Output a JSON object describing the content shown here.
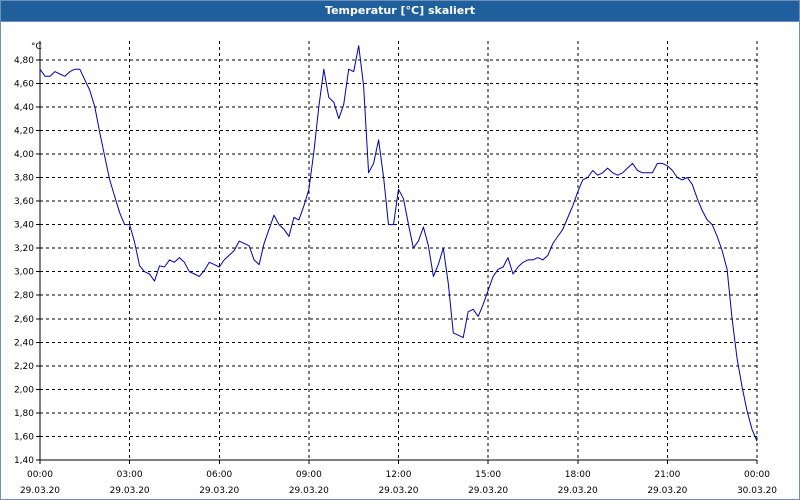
{
  "window": {
    "title": "Temperatur [°C] skaliert"
  },
  "chart_data": {
    "type": "line",
    "title": "Temperatur [°C] skaliert",
    "ylabel": "°C",
    "xlabel": "",
    "ylim": [
      1.4,
      4.96
    ],
    "grid": true,
    "y_ticks": [
      "1,40",
      "1,60",
      "1,80",
      "2,00",
      "2,20",
      "2,40",
      "2,60",
      "2,80",
      "3,00",
      "3,20",
      "3,40",
      "3,60",
      "3,80",
      "4,00",
      "4,20",
      "4,40",
      "4,60",
      "4,80"
    ],
    "x_ticks": [
      {
        "time": "00:00",
        "date": "29.03.20"
      },
      {
        "time": "03:00",
        "date": "29.03.20"
      },
      {
        "time": "06:00",
        "date": "29.03.20"
      },
      {
        "time": "09:00",
        "date": "29.03.20"
      },
      {
        "time": "12:00",
        "date": "29.03.20"
      },
      {
        "time": "15:00",
        "date": "29.03.20"
      },
      {
        "time": "18:00",
        "date": "29.03.20"
      },
      {
        "time": "21:00",
        "date": "29.03.20"
      },
      {
        "time": "00:00",
        "date": "30.03.20"
      }
    ],
    "series": [
      {
        "color": "#0000b4",
        "x": [
          "29.03.20 00:00",
          "29.03.20 00:10",
          "29.03.20 00:20",
          "29.03.20 00:30",
          "29.03.20 00:40",
          "29.03.20 00:50",
          "29.03.20 01:00",
          "29.03.20 01:10",
          "29.03.20 01:20",
          "29.03.20 01:30",
          "29.03.20 01:40",
          "29.03.20 01:50",
          "29.03.20 02:00",
          "29.03.20 02:10",
          "29.03.20 02:20",
          "29.03.20 02:30",
          "29.03.20 02:40",
          "29.03.20 02:50",
          "29.03.20 03:00",
          "29.03.20 03:10",
          "29.03.20 03:20",
          "29.03.20 03:30",
          "29.03.20 03:40",
          "29.03.20 03:50",
          "29.03.20 04:00",
          "29.03.20 04:10",
          "29.03.20 04:20",
          "29.03.20 04:30",
          "29.03.20 04:40",
          "29.03.20 04:50",
          "29.03.20 05:00",
          "29.03.20 05:10",
          "29.03.20 05:20",
          "29.03.20 05:30",
          "29.03.20 05:40",
          "29.03.20 05:50",
          "29.03.20 06:00",
          "29.03.20 06:10",
          "29.03.20 06:20",
          "29.03.20 06:30",
          "29.03.20 06:40",
          "29.03.20 06:50",
          "29.03.20 07:00",
          "29.03.20 07:10",
          "29.03.20 07:20",
          "29.03.20 07:30",
          "29.03.20 07:40",
          "29.03.20 07:50",
          "29.03.20 08:00",
          "29.03.20 08:10",
          "29.03.20 08:20",
          "29.03.20 08:30",
          "29.03.20 08:40",
          "29.03.20 08:50",
          "29.03.20 09:00",
          "29.03.20 09:10",
          "29.03.20 09:20",
          "29.03.20 09:30",
          "29.03.20 09:40",
          "29.03.20 09:50",
          "29.03.20 10:00",
          "29.03.20 10:10",
          "29.03.20 10:20",
          "29.03.20 10:30",
          "29.03.20 10:40",
          "29.03.20 10:50",
          "29.03.20 11:00",
          "29.03.20 11:10",
          "29.03.20 11:20",
          "29.03.20 11:30",
          "29.03.20 11:40",
          "29.03.20 11:50",
          "29.03.20 12:00",
          "29.03.20 12:10",
          "29.03.20 12:20",
          "29.03.20 12:30",
          "29.03.20 12:40",
          "29.03.20 12:50",
          "29.03.20 13:00",
          "29.03.20 13:10",
          "29.03.20 13:20",
          "29.03.20 13:30",
          "29.03.20 13:40",
          "29.03.20 13:50",
          "29.03.20 14:00",
          "29.03.20 14:10",
          "29.03.20 14:20",
          "29.03.20 14:30",
          "29.03.20 14:40",
          "29.03.20 14:50",
          "29.03.20 15:00",
          "29.03.20 15:10",
          "29.03.20 15:20",
          "29.03.20 15:30",
          "29.03.20 15:40",
          "29.03.20 15:50",
          "29.03.20 16:00",
          "29.03.20 16:10",
          "29.03.20 16:20",
          "29.03.20 16:30",
          "29.03.20 16:40",
          "29.03.20 16:50",
          "29.03.20 17:00",
          "29.03.20 17:10",
          "29.03.20 17:20",
          "29.03.20 17:30",
          "29.03.20 17:40",
          "29.03.20 17:50",
          "29.03.20 18:00",
          "29.03.20 18:10",
          "29.03.20 18:20",
          "29.03.20 18:30",
          "29.03.20 18:40",
          "29.03.20 18:50",
          "29.03.20 19:00",
          "29.03.20 19:10",
          "29.03.20 19:20",
          "29.03.20 19:30",
          "29.03.20 19:40",
          "29.03.20 19:50",
          "29.03.20 20:00",
          "29.03.20 20:10",
          "29.03.20 20:20",
          "29.03.20 20:30",
          "29.03.20 20:40",
          "29.03.20 20:50",
          "29.03.20 21:00",
          "29.03.20 21:10",
          "29.03.20 21:20",
          "29.03.20 21:30",
          "29.03.20 21:40",
          "29.03.20 21:50",
          "29.03.20 22:00",
          "29.03.20 22:10",
          "29.03.20 22:20",
          "29.03.20 22:30",
          "29.03.20 22:40",
          "29.03.20 22:50",
          "29.03.20 23:00",
          "29.03.20 23:10",
          "29.03.20 23:20",
          "29.03.20 23:30",
          "29.03.20 23:40",
          "29.03.20 23:50",
          "30.03.20 00:00"
        ],
        "y": [
          4.72,
          4.66,
          4.66,
          4.7,
          4.68,
          4.66,
          4.7,
          4.72,
          4.72,
          4.63,
          4.54,
          4.4,
          4.18,
          3.98,
          3.78,
          3.64,
          3.5,
          3.4,
          3.4,
          3.25,
          3.05,
          3.0,
          2.98,
          2.92,
          3.05,
          3.04,
          3.1,
          3.08,
          3.12,
          3.08,
          3.0,
          2.98,
          2.96,
          3.01,
          3.08,
          3.06,
          3.04,
          3.1,
          3.14,
          3.18,
          3.26,
          3.24,
          3.22,
          3.1,
          3.06,
          3.24,
          3.36,
          3.48,
          3.4,
          3.36,
          3.3,
          3.46,
          3.44,
          3.56,
          3.7,
          4.02,
          4.4,
          4.72,
          4.48,
          4.44,
          4.3,
          4.42,
          4.72,
          4.7,
          4.92,
          4.58,
          3.84,
          3.92,
          4.12,
          3.8,
          3.4,
          3.4,
          3.7,
          3.62,
          3.4,
          3.2,
          3.26,
          3.38,
          3.22,
          2.96,
          3.06,
          3.2,
          2.9,
          2.48,
          2.46,
          2.44,
          2.66,
          2.68,
          2.62,
          2.72,
          2.84,
          2.96,
          3.02,
          3.04,
          3.12,
          2.98,
          3.04,
          3.08,
          3.1,
          3.1,
          3.12,
          3.1,
          3.14,
          3.24,
          3.3,
          3.36,
          3.46,
          3.56,
          3.68,
          3.78,
          3.8,
          3.86,
          3.82,
          3.84,
          3.88,
          3.84,
          3.82,
          3.84,
          3.88,
          3.92,
          3.86,
          3.84,
          3.84,
          3.84,
          3.92,
          3.92,
          3.9,
          3.86,
          3.8,
          3.78,
          3.8,
          3.74,
          3.62,
          3.52,
          3.44,
          3.4,
          3.3,
          3.18,
          3.02,
          2.6,
          2.26,
          2.02,
          1.82,
          1.66,
          1.56
        ]
      }
    ]
  }
}
